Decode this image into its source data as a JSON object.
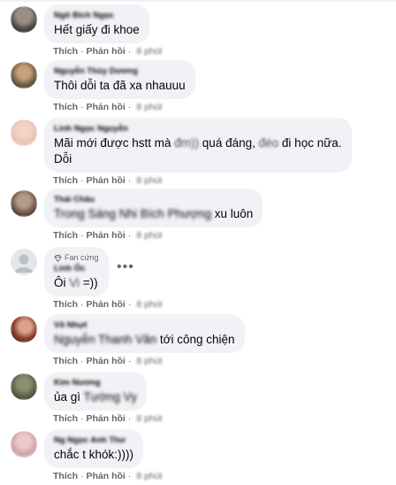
{
  "actions": {
    "like": "Thích",
    "reply": "Phản hồi",
    "dot": "·",
    "time": "8 phút"
  },
  "fan_badge": {
    "icon": "diamond-icon",
    "label": "Fan cứng"
  },
  "more_icon": "more-horizontal-icon",
  "comments": [
    {
      "author": "Ngô Bích Ngọc",
      "text": "Hết giấy đi khoe"
    },
    {
      "author": "Nguyễn Thùy Dương",
      "text": "Thôi dỗi ta đã xa nhauuu"
    },
    {
      "author": "Linh Ngọc Nguyễn",
      "text_1": "Mãi mới được hstt mà",
      "blur_1": "đm))",
      "text_2": "quá đáng,",
      "blur_2": "đéo",
      "text_3": "đi học nữa.",
      "line2": "Dỗi"
    },
    {
      "author": "Thái Châu",
      "mention": "Trong Sáng Nhi Bích Phượng",
      "text": " xu luôn"
    },
    {
      "author": "Linh Ốc",
      "text_1": "Ôi",
      "blur": "Vi",
      "text_2": "=))"
    },
    {
      "author": "Võ Nhựt",
      "mention": "Nguyễn Thanh Vân",
      "text": " tới công chiện"
    },
    {
      "author": "Kim Nương",
      "text": "ủa gì ",
      "mention": "Tường Vy"
    },
    {
      "author": "Ng Ngọc Anh Thư",
      "text": "chắc t khók:))))"
    }
  ]
}
